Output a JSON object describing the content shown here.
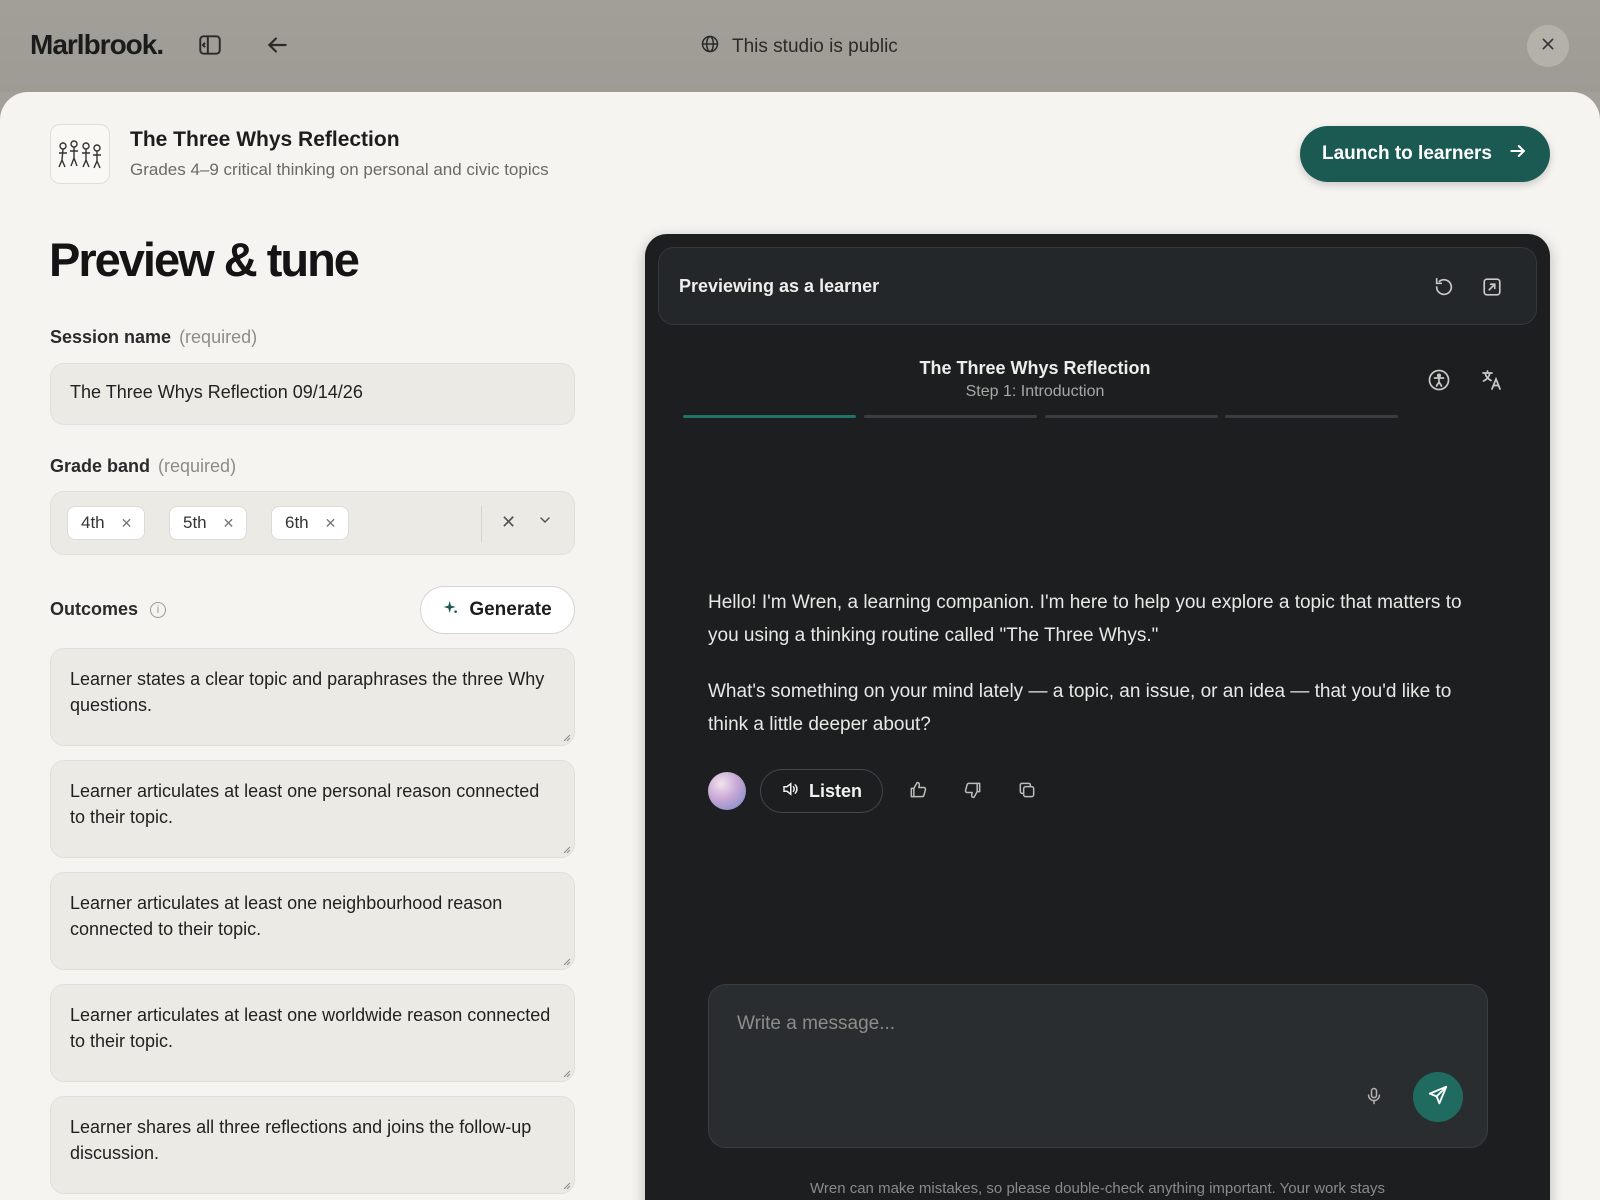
{
  "topbar": {
    "brand": "Marlbrook.",
    "visibility_text": "This studio is public"
  },
  "studio": {
    "title": "The Three Whys Reflection",
    "subtitle": "Grades 4–9 critical thinking on personal and civic topics",
    "launch_label": "Launch to learners"
  },
  "form": {
    "page_title": "Preview & tune",
    "session_name_label": "Session name",
    "required_text": "(required)",
    "session_name_value": "The Three Whys Reflection 09/14/26",
    "grade_band_label": "Grade band",
    "grades": [
      "4th",
      "5th",
      "6th"
    ],
    "outcomes_label": "Outcomes",
    "generate_label": "Generate",
    "outcomes": [
      "Learner states a clear topic and paraphrases the three Why questions.",
      "Learner articulates at least one personal reason connected to their topic.",
      "Learner articulates at least one neighbourhood reason connected to their topic.",
      "Learner articulates at least one worldwide reason connected to their topic.",
      "Learner shares all three reflections and joins the follow-up discussion."
    ]
  },
  "preview": {
    "header_label": "Previewing as a learner",
    "session_title": "The Three Whys Reflection",
    "step_label": "Step 1: Introduction",
    "progress": {
      "current_step": 1,
      "total_steps": 4
    },
    "message_paragraphs": [
      "Hello! I'm Wren, a learning companion. I'm here to help you explore a topic that matters to you using a thinking routine called \"The Three Whys.\"",
      "What's something on your mind lately — a topic, an issue, or an idea — that you'd like to think a little deeper about?"
    ],
    "listen_label": "Listen",
    "composer_placeholder": "Write a message...",
    "disclaimer": "Wren can make mistakes, so please double-check anything important. Your work stays"
  },
  "colors": {
    "accent": "#1b5a53",
    "progress_active": "#1f7468",
    "preview_bg": "#1c1e20",
    "sheet_bg": "#f5f4f0"
  },
  "icons": [
    "sidebar-toggle-icon",
    "back-arrow-icon",
    "globe-icon",
    "close-icon",
    "arrow-right-icon",
    "sparkle-icon",
    "info-icon",
    "chevron-down-icon",
    "restart-icon",
    "open-external-icon",
    "accessibility-icon",
    "translate-icon",
    "speaker-icon",
    "thumbs-up-icon",
    "thumbs-down-icon",
    "copy-icon",
    "microphone-icon",
    "send-icon"
  ]
}
